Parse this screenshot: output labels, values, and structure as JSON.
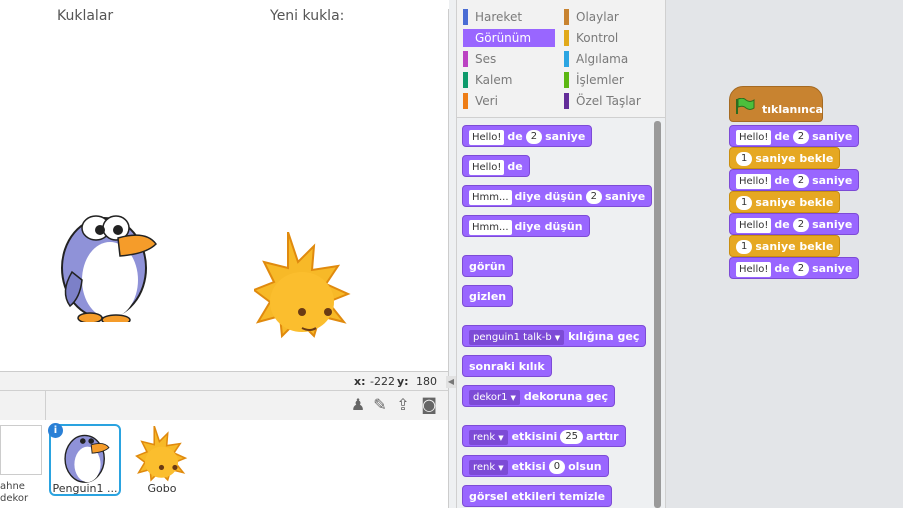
{
  "stage": {
    "coords": {
      "x_label": "x:",
      "x_value": "-222",
      "y_label": "y:",
      "y_value": "180"
    }
  },
  "sprites_pane": {
    "title": "Kuklalar",
    "new_sprite_label": "Yeni kukla:",
    "stage_label_line1": "ahne",
    "stage_label_line2": "dekor",
    "info_badge": "i",
    "sprites": [
      {
        "name": "Penguin1 ..."
      },
      {
        "name": "Gobo"
      }
    ]
  },
  "categories": [
    {
      "label": "Hareket",
      "color": "#4a6cd4"
    },
    {
      "label": "Olaylar",
      "color": "#c88330"
    },
    {
      "label": "Görünüm",
      "color": "#9966ff",
      "active": true
    },
    {
      "label": "Kontrol",
      "color": "#e1a91a"
    },
    {
      "label": "Ses",
      "color": "#bb42c3"
    },
    {
      "label": "Algılama",
      "color": "#2ca5e2"
    },
    {
      "label": "Kalem",
      "color": "#0e9a6c"
    },
    {
      "label": "İşlemler",
      "color": "#5cb712"
    },
    {
      "label": "Veri",
      "color": "#ee7d16"
    },
    {
      "label": "Özel Taşlar",
      "color": "#632d99"
    }
  ],
  "palette": {
    "say_secs": {
      "text_value": "Hello!",
      "word1": "de",
      "num": "2",
      "word2": "saniye"
    },
    "say": {
      "text_value": "Hello!",
      "word1": "de"
    },
    "think_secs": {
      "text_value": "Hmm...",
      "word1": "diye düşün",
      "num": "2",
      "word2": "saniye"
    },
    "think": {
      "text_value": "Hmm...",
      "word1": "diye düşün"
    },
    "show": "görün",
    "hide": "gizlen",
    "switch_costume": {
      "value": "penguin1 talk-b",
      "word": "kılığına geç"
    },
    "next_costume": "sonraki kılık",
    "switch_backdrop": {
      "value": "dekor1",
      "word": "dekoruna geç"
    },
    "change_effect": {
      "value": "renk",
      "word1": "etkisini",
      "num": "25",
      "word2": "arttır"
    },
    "set_effect": {
      "value": "renk",
      "word1": "etkisi",
      "num": "0",
      "word2": "olsun"
    },
    "clear_effects": "görsel etkileri temizle"
  },
  "script": {
    "hat_label": "tıklanınca",
    "blocks": [
      {
        "text_value": "Hello!",
        "word1": "de",
        "num": "2",
        "word2": "saniye"
      },
      {
        "num": "1",
        "word": "saniye bekle"
      },
      {
        "text_value": "Hello!",
        "word1": "de",
        "num": "2",
        "word2": "saniye"
      },
      {
        "num": "1",
        "word": "saniye bekle"
      },
      {
        "text_value": "Hello!",
        "word1": "de",
        "num": "2",
        "word2": "saniye"
      },
      {
        "num": "1",
        "word": "saniye bekle"
      },
      {
        "text_value": "Hello!",
        "word1": "de",
        "num": "2",
        "word2": "saniye"
      }
    ]
  },
  "colors": {
    "looks": "#9966ff",
    "control": "#e6a822",
    "events": "#c88330",
    "selection": "#2aa3e0"
  }
}
